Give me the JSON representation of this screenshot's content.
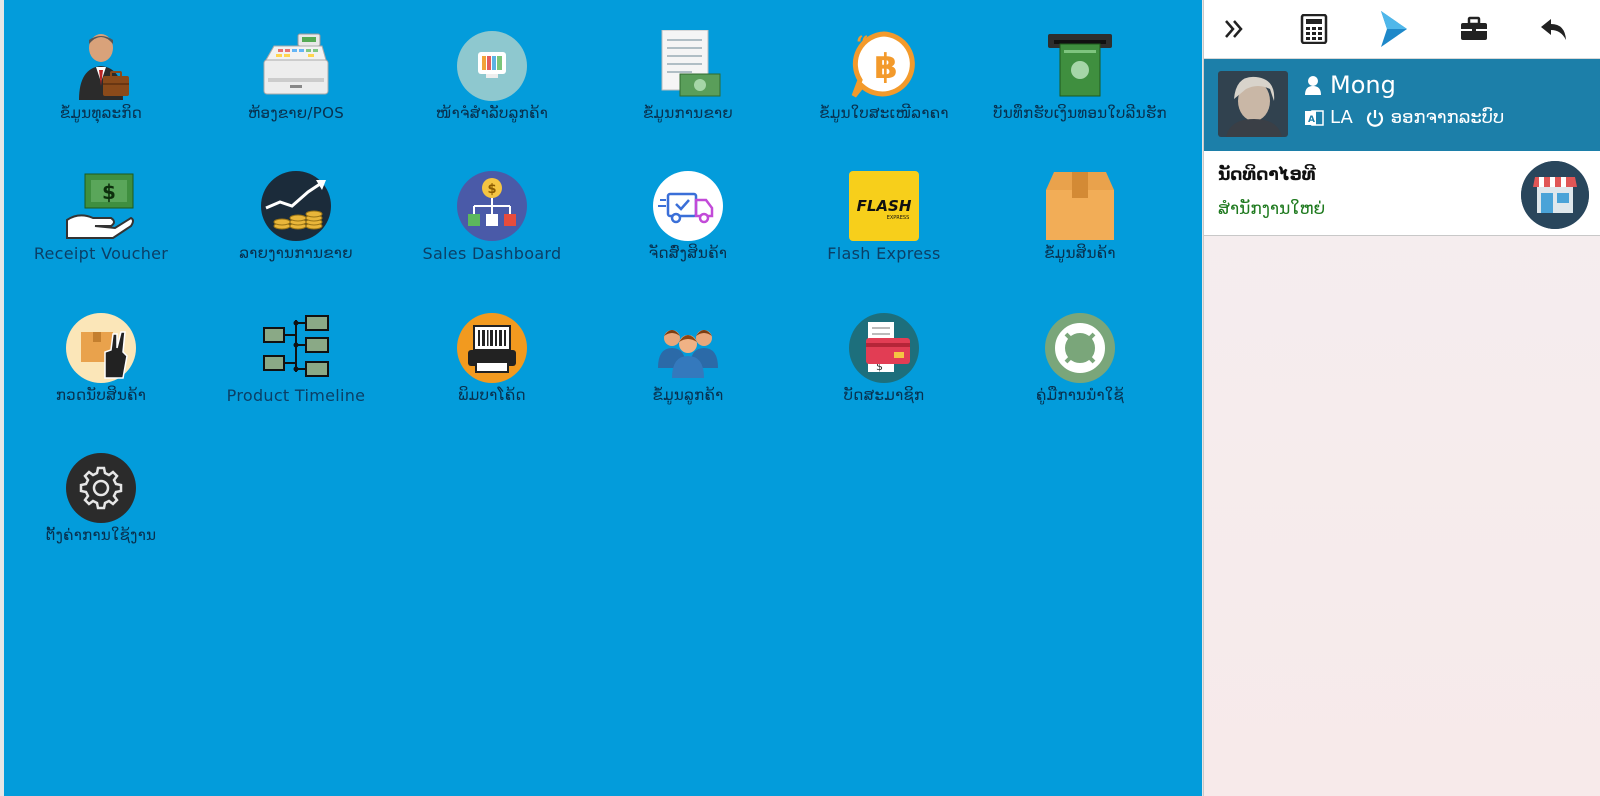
{
  "tiles": [
    {
      "label": "ຂໍ້ມູນທຸລະກິດ",
      "icon": "businessman-icon"
    },
    {
      "label": "ຫ້ອງຂາຍ/POS",
      "icon": "cash-register-icon"
    },
    {
      "label": "ໜ້າຈໍສໍາລັບລູກຄ້າ",
      "icon": "customer-display-icon"
    },
    {
      "label": "ຂໍ້ມູນການຂາຍ",
      "icon": "sales-invoice-icon"
    },
    {
      "label": "ຂໍ້ມູນໃບສະເໜີລາຄາ",
      "icon": "quotation-icon"
    },
    {
      "label": "ບັນທຶກຮັບເງິນທອນໃບລີນຮັກ",
      "icon": "atm-cash-icon"
    },
    {
      "label": "Receipt Voucher",
      "icon": "receipt-voucher-icon"
    },
    {
      "label": "ລາຍງານການຂາຍ",
      "icon": "sales-report-icon"
    },
    {
      "label": "Sales Dashboard",
      "icon": "sales-dashboard-icon"
    },
    {
      "label": "ຈັດສົ່ງສິນຄ້າ",
      "icon": "delivery-truck-icon"
    },
    {
      "label": "Flash Express",
      "icon": "flash-express-icon"
    },
    {
      "label": "ຂໍ້ມູນສິນຄ້າ",
      "icon": "product-box-icon"
    },
    {
      "label": "ກວດນັບສິນຄ້າ",
      "icon": "stock-count-icon"
    },
    {
      "label": "Product Timeline",
      "icon": "product-timeline-icon"
    },
    {
      "label": "ພິມບາໂຄ້ດ",
      "icon": "barcode-printer-icon"
    },
    {
      "label": "ຂໍ້ມູນລູກຄ້າ",
      "icon": "customers-icon"
    },
    {
      "label": "ບັດສະມາຊິກ",
      "icon": "member-card-icon"
    },
    {
      "label": "ຄູ່ມືການນໍາໃຊ້",
      "icon": "lifebuoy-icon"
    },
    {
      "label": "ຕັ້ງຄ່າການໃຊ້ງານ",
      "icon": "settings-gear-icon"
    }
  ],
  "toolbar": {
    "items": [
      "expand-icon",
      "calculator-icon",
      "app-logo-icon",
      "briefcase-icon",
      "back-arrow-icon"
    ]
  },
  "user": {
    "name": "Mong",
    "lang": "LA",
    "logout": "ອອກຈາກລະບົບ"
  },
  "shop": {
    "title": "ນັດທິດາໄອທີ",
    "subtitle": "ສໍານັກງານໃຫຍ່"
  },
  "colors": {
    "main_bg": "#039cdb",
    "userbar_bg": "#1c7fa9",
    "accent": "#1c7fa9"
  }
}
